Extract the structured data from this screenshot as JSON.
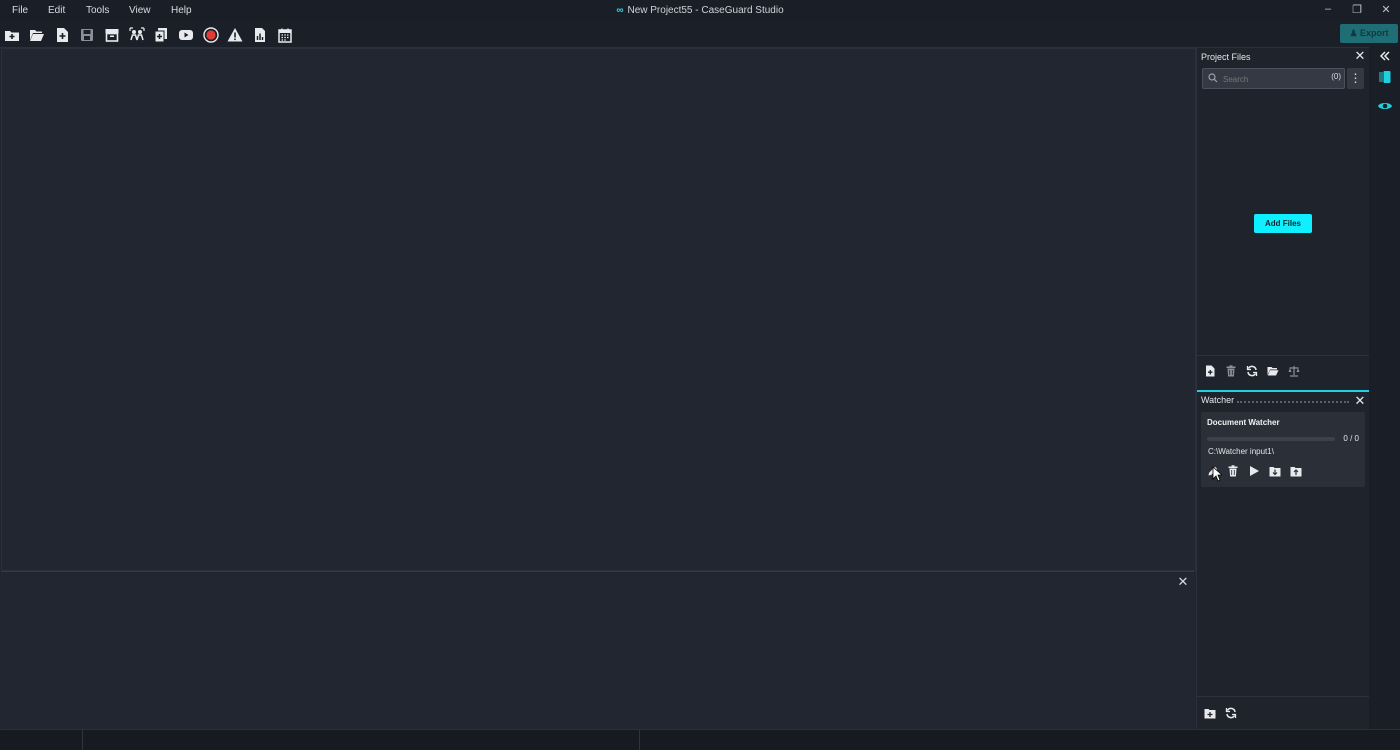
{
  "app": {
    "title": "New Project55 - CaseGuard Studio"
  },
  "menu": [
    "File",
    "Edit",
    "Tools",
    "View",
    "Help"
  ],
  "window_controls": [
    "minimize",
    "restore",
    "close"
  ],
  "toolbar": {
    "icons": [
      "new-project-icon",
      "open-folder-icon",
      "add-file-icon",
      "save-icon",
      "archive-icon",
      "people-detect-icon",
      "copy-icon",
      "youtube-icon",
      "record-icon",
      "warning-icon",
      "report-icon",
      "calendar-icon"
    ],
    "export_label": "Export",
    "accent": "#1f6e76"
  },
  "project_files": {
    "title": "Project Files",
    "search_placeholder": "Search",
    "count": "(0)",
    "add_files_label": "Add Files",
    "tools": [
      "add-file-icon",
      "trash-icon",
      "refresh-icon",
      "folder-icon",
      "scale-icon"
    ]
  },
  "watcher": {
    "title": "Watcher",
    "card": {
      "name": "Document Watcher",
      "progress": 0,
      "count": "0 / 0",
      "path": "C:\\Watcher input1\\",
      "tools": [
        "edit-icon",
        "trash-icon",
        "play-icon",
        "import-icon",
        "export-icon"
      ]
    },
    "footer_tools": [
      "add-folder-icon",
      "refresh-icon"
    ]
  },
  "side_rail": [
    "panel-toggle-icon",
    "eye-icon"
  ],
  "colors": {
    "accent": "#0ef0ff",
    "background": "#202530"
  }
}
